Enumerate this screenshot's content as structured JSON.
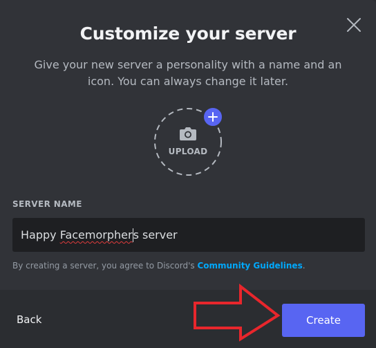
{
  "dialog": {
    "title": "Customize your server",
    "subtitle": "Give your new server a personality with a name and an icon. You can always change it later."
  },
  "upload": {
    "label": "UPLOAD",
    "icon": "camera-icon",
    "badge_icon": "plus-icon"
  },
  "server_name": {
    "label": "SERVER NAME",
    "value_prefix": "Happy ",
    "value_misspelled": "Facemorpher",
    "value_after_caret": "s server",
    "value": "Happy Facemorpher's server"
  },
  "terms": {
    "text": "By creating a server, you agree to Discord's ",
    "link": "Community Guidelines",
    "suffix": "."
  },
  "footer": {
    "back_label": "Back",
    "create_label": "Create"
  },
  "colors": {
    "background": "#313338",
    "footer": "#2b2d31",
    "accent": "#5865f2",
    "link": "#00a8fc",
    "annotation_arrow": "#e8262c"
  }
}
